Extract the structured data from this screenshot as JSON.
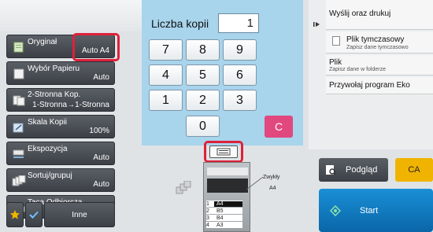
{
  "copies": {
    "label": "Liczba kopii",
    "value": "1"
  },
  "keypad": {
    "keys": [
      "7",
      "8",
      "9",
      "4",
      "5",
      "6",
      "1",
      "2",
      "3",
      "0"
    ],
    "clear_label": "C"
  },
  "functions": [
    {
      "title": "Oryginał",
      "value": "Auto  A4"
    },
    {
      "title": "Wybór Papieru",
      "value": "Auto"
    },
    {
      "title": "2-Stronna Kop.",
      "value": "1-Stronna→1-Stronna"
    },
    {
      "title": "Skala Kopii",
      "value": "100%"
    },
    {
      "title": "Ekspozycja",
      "value": "Auto"
    },
    {
      "title": "Sortuj/grupuj",
      "value": "Auto"
    },
    {
      "title": "Taca Odbiorcza",
      "value": ""
    }
  ],
  "bottom_left": {
    "other_label": "Inne"
  },
  "right_panel": {
    "send_print_label": "Wyślij oraz drukuj",
    "temp_file_label": "Plik tymczasowy",
    "temp_file_sub": "Zapisz dane tymczasowo",
    "file_label": "Plik",
    "file_sub": "Zapisz dane w folderze",
    "eco_label": "Przywołaj program Eko"
  },
  "actions": {
    "preview_label": "Podgląd",
    "ca_label": "CA",
    "start_label": "Start"
  },
  "paper": {
    "type": "Zwykły",
    "size": "A4",
    "trays": [
      {
        "num": "1",
        "size": "A4"
      },
      {
        "num": "2",
        "size": "B5"
      },
      {
        "num": "3",
        "size": "B4"
      },
      {
        "num": "4",
        "size": "A3"
      }
    ]
  },
  "colors": {
    "keypad_bg": "#a8d4ec",
    "clear_key": "#e0487e",
    "ca_button": "#f0b400",
    "start_button": "#0a66a8",
    "highlight": "#e0203a"
  }
}
